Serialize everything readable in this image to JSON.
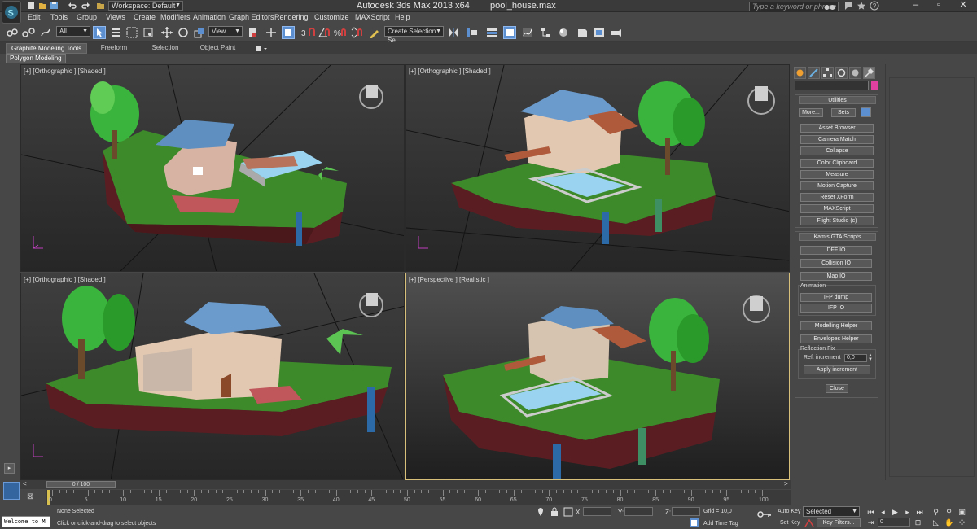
{
  "titlebar": {
    "workspace": "Workspace: Default",
    "app_title": "Autodesk 3ds Max  2013 x64",
    "file_title": "pool_house.max",
    "search_placeholder": "Type a keyword or phrase"
  },
  "menu": [
    "Edit",
    "Tools",
    "Group",
    "Views",
    "Create",
    "Modifiers",
    "Animation",
    "Graph Editors",
    "Rendering",
    "Customize",
    "MAXScript",
    "Help"
  ],
  "toolbar": {
    "selection_filter": "All",
    "ref_coord": "View",
    "named_selection": "Create Selection Se"
  },
  "ribbon": {
    "tabs": [
      "Graphite Modeling Tools",
      "Freeform",
      "Selection",
      "Object Paint"
    ],
    "active_tab": 0,
    "subtab": "Polygon Modeling"
  },
  "viewports": [
    {
      "label": "[+] [Orthographic ] [Shaded ]",
      "active": false
    },
    {
      "label": "[+] [Orthographic ] [Shaded ]",
      "active": false
    },
    {
      "label": "[+] [Orthographic ] [Shaded ]",
      "active": false
    },
    {
      "label": "[+] [Perspective ] [Realistic ]",
      "active": true
    }
  ],
  "command_panel": {
    "utilities": {
      "title": "Utilities",
      "more": "More...",
      "sets": "Sets",
      "buttons": [
        "Asset Browser",
        "Camera Match",
        "Collapse",
        "Color Clipboard",
        "Measure",
        "Motion Capture",
        "Reset XForm",
        "MAXScript",
        "Flight Studio (c)"
      ]
    },
    "gta": {
      "title": "Kam's GTA Scripts",
      "buttons": [
        "DFF IO",
        "Collision IO",
        "Map IO"
      ],
      "animation_label": "Animation",
      "animation_buttons": [
        "IFP dump",
        "IFP IO"
      ],
      "helpers": [
        "Modelling Helper",
        "Envelopes Helper"
      ],
      "reflection_label": "Reflection Fix",
      "ref_increment_label": "Ref. increment",
      "ref_increment_value": "0,0",
      "apply_increment": "Apply increment",
      "close": "Close"
    }
  },
  "timeline": {
    "slider_text": "0 / 100",
    "ticks": [
      "0",
      "5",
      "10",
      "15",
      "20",
      "25",
      "30",
      "35",
      "40",
      "45",
      "50",
      "55",
      "60",
      "65",
      "70",
      "75",
      "80",
      "85",
      "90",
      "95",
      "100"
    ]
  },
  "status": {
    "maxscript": "Welcome to M",
    "selection": "None Selected",
    "prompt": "Click or click-and-drag to select objects",
    "x_label": "X:",
    "y_label": "Y:",
    "z_label": "Z:",
    "grid": "Grid = 10,0",
    "add_time_tag": "Add Time Tag",
    "auto_key": "Auto Key",
    "set_key": "Set Key",
    "key_mode": "Selected",
    "key_filters": "Key Filters...",
    "frame": "0"
  },
  "colors": {
    "accent": "#5b8fd0",
    "active_viewport": "#d8c07a",
    "grass": "#3f8a2d",
    "soil": "#5a1e20",
    "roof": "#5e8fc0",
    "pool": "#9ad3ef"
  }
}
